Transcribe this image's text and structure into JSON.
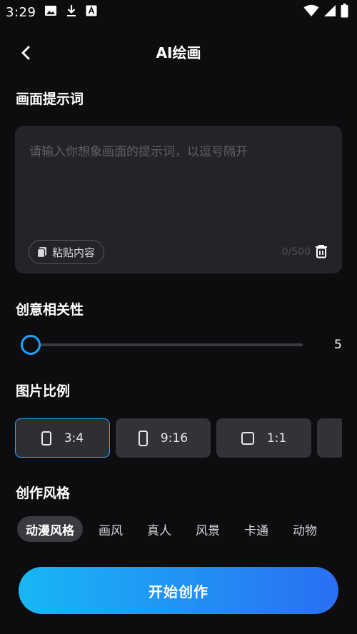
{
  "status_bar": {
    "time": "3:29",
    "icons": [
      "image-icon",
      "download-icon",
      "font-icon",
      "wifi-icon",
      "signal-icon",
      "battery-icon"
    ]
  },
  "header": {
    "title": "AI绘画",
    "back_icon": "chevron-left-icon"
  },
  "prompt": {
    "section_title": "画面提示词",
    "placeholder": "请输入你想象画面的提示词，以逗号隔开",
    "paste_label": "粘贴内容",
    "char_count": "0/500",
    "trash_icon": "trash-icon"
  },
  "relevance": {
    "section_title": "创意相关性",
    "value": "5"
  },
  "ratio": {
    "section_title": "图片比例",
    "options": [
      {
        "label": "3:4",
        "icon": "portrait-rect-icon",
        "active": true
      },
      {
        "label": "9:16",
        "icon": "tall-portrait-rect-icon",
        "active": false
      },
      {
        "label": "1:1",
        "icon": "square-icon",
        "active": false
      }
    ]
  },
  "style": {
    "section_title": "创作风格",
    "options": [
      "动漫风格",
      "画风",
      "真人",
      "风景",
      "卡通",
      "动物"
    ],
    "active_index": 0
  },
  "start_button": {
    "label": "开始创作"
  },
  "colors": {
    "background": "#0d0d0f",
    "accent": "#1aa3ff",
    "button_gradient_start": "#18b7f5",
    "button_gradient_end": "#2a6ff3"
  }
}
